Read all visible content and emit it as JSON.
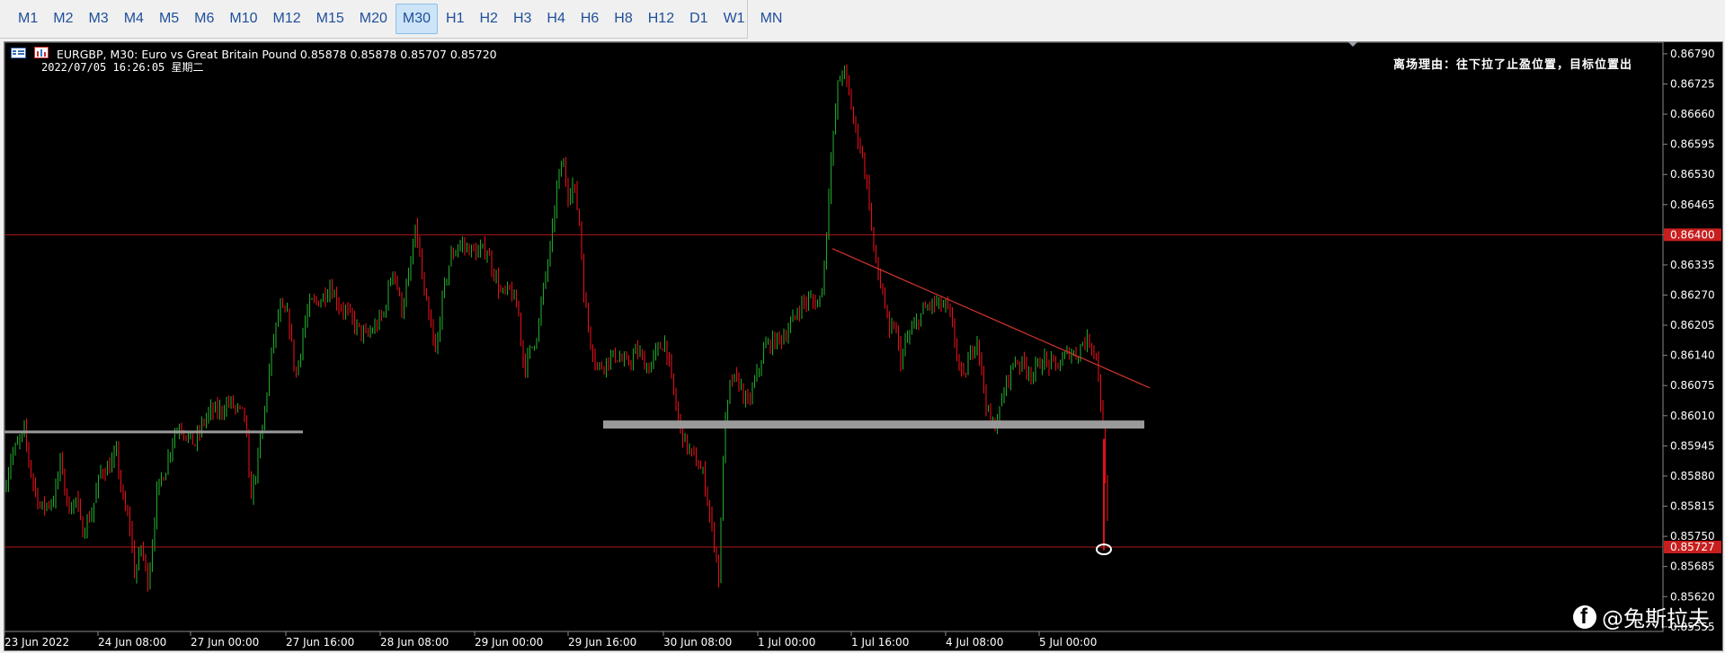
{
  "timeframes": [
    "M1",
    "M2",
    "M3",
    "M4",
    "M5",
    "M6",
    "M10",
    "M12",
    "M15",
    "M20",
    "M30",
    "H1",
    "H2",
    "H3",
    "H4",
    "H6",
    "H8",
    "H12",
    "D1",
    "W1",
    "MN"
  ],
  "active_timeframe": "M30",
  "chart": {
    "header": "EURGBP, M30:  Euro vs Great Britain Pound  0.85878 0.85878 0.85707 0.85720",
    "datetime": "2022/07/05  16:26:05  星期二",
    "note": "离场理由：往下拉了止盈位置，目标位置出",
    "watermark": "@兔斯拉夫",
    "colors": {
      "bull": "#1fa52a",
      "bear": "#e0101a",
      "background": "#000000",
      "hline": "#b01818",
      "zone": "#9a9a9a",
      "price_box": "#c81e1e"
    }
  },
  "chart_data": {
    "type": "candlestick",
    "symbol": "EURGBP",
    "timeframe": "M30",
    "ylim": [
      0.85545,
      0.86815
    ],
    "y_ticks": [
      "0.86790",
      "0.86725",
      "0.86660",
      "0.86595",
      "0.86530",
      "0.86465",
      "0.86400",
      "0.86335",
      "0.86270",
      "0.86205",
      "0.86140",
      "0.86075",
      "0.86010",
      "0.85945",
      "0.85880",
      "0.85815",
      "0.85750",
      "0.85685",
      "0.85620",
      "0.85555"
    ],
    "x_ticks": [
      "23 Jun 2022",
      "24 Jun 08:00",
      "27 Jun 00:00",
      "27 Jun 16:00",
      "28 Jun 08:00",
      "29 Jun 00:00",
      "29 Jun 16:00",
      "30 Jun 08:00",
      "1 Jul 00:00",
      "1 Jul 16:00",
      "4 Jul 08:00",
      "5 Jul 00:00"
    ],
    "price_labels": [
      "0.86400",
      "0.85727"
    ],
    "horizontal_lines": [
      0.864,
      0.85727
    ],
    "support_zones": [
      0.85975,
      0.8599
    ],
    "trendline": [
      0.8637,
      0.8607
    ],
    "last_close": 0.8572,
    "path": [
      [
        0,
        0.8585
      ],
      [
        7,
        0.8592
      ],
      [
        22,
        0.85975
      ],
      [
        30,
        0.8588
      ],
      [
        40,
        0.8581
      ],
      [
        55,
        0.8583
      ],
      [
        63,
        0.8592
      ],
      [
        70,
        0.8581
      ],
      [
        80,
        0.8583
      ],
      [
        86,
        0.8576
      ],
      [
        97,
        0.858
      ],
      [
        107,
        0.8589
      ],
      [
        117,
        0.859
      ],
      [
        125,
        0.8593
      ],
      [
        131,
        0.8583
      ],
      [
        140,
        0.8577
      ],
      [
        145,
        0.8566
      ],
      [
        152,
        0.8573
      ],
      [
        160,
        0.8565
      ],
      [
        170,
        0.8585
      ],
      [
        180,
        0.859
      ],
      [
        188,
        0.8597
      ],
      [
        196,
        0.8599
      ],
      [
        205,
        0.8596
      ],
      [
        212,
        0.8595
      ],
      [
        222,
        0.86
      ],
      [
        230,
        0.8602
      ],
      [
        240,
        0.8602
      ],
      [
        250,
        0.8604
      ],
      [
        260,
        0.8602
      ],
      [
        268,
        0.8601
      ],
      [
        273,
        0.8583
      ],
      [
        280,
        0.8589
      ],
      [
        288,
        0.86
      ],
      [
        298,
        0.8616
      ],
      [
        306,
        0.8624
      ],
      [
        316,
        0.8622
      ],
      [
        324,
        0.8609
      ],
      [
        334,
        0.8621
      ],
      [
        340,
        0.8625
      ],
      [
        352,
        0.8626
      ],
      [
        362,
        0.8629
      ],
      [
        372,
        0.8625
      ],
      [
        382,
        0.8623
      ],
      [
        392,
        0.862
      ],
      [
        402,
        0.8618
      ],
      [
        412,
        0.862
      ],
      [
        422,
        0.8623
      ],
      [
        432,
        0.8633
      ],
      [
        442,
        0.8624
      ],
      [
        450,
        0.8631
      ],
      [
        458,
        0.8642
      ],
      [
        466,
        0.8628
      ],
      [
        473,
        0.8621
      ],
      [
        480,
        0.8614
      ],
      [
        486,
        0.8625
      ],
      [
        496,
        0.8635
      ],
      [
        506,
        0.8638
      ],
      [
        516,
        0.8637
      ],
      [
        526,
        0.8636
      ],
      [
        536,
        0.8637
      ],
      [
        546,
        0.8631
      ],
      [
        553,
        0.8627
      ],
      [
        563,
        0.8628
      ],
      [
        572,
        0.8623
      ],
      [
        578,
        0.8611
      ],
      [
        585,
        0.8615
      ],
      [
        593,
        0.8619
      ],
      [
        600,
        0.8629
      ],
      [
        608,
        0.8638
      ],
      [
        615,
        0.8651
      ],
      [
        621,
        0.8656
      ],
      [
        627,
        0.8649
      ],
      [
        633,
        0.8651
      ],
      [
        640,
        0.8642
      ],
      [
        645,
        0.8626
      ],
      [
        652,
        0.8617
      ],
      [
        660,
        0.8611
      ],
      [
        670,
        0.8613
      ],
      [
        680,
        0.8614
      ],
      [
        692,
        0.8612
      ],
      [
        704,
        0.8615
      ],
      [
        716,
        0.8611
      ],
      [
        726,
        0.8615
      ],
      [
        735,
        0.8617
      ],
      [
        740,
        0.8611
      ],
      [
        746,
        0.8604
      ],
      [
        752,
        0.8598
      ],
      [
        760,
        0.8594
      ],
      [
        770,
        0.8591
      ],
      [
        778,
        0.8588
      ],
      [
        785,
        0.8579
      ],
      [
        791,
        0.8572
      ],
      [
        795,
        0.8565
      ],
      [
        800,
        0.8596
      ],
      [
        808,
        0.8609
      ],
      [
        818,
        0.8608
      ],
      [
        826,
        0.8603
      ],
      [
        836,
        0.8609
      ],
      [
        846,
        0.8616
      ],
      [
        856,
        0.8617
      ],
      [
        866,
        0.8618
      ],
      [
        876,
        0.8621
      ],
      [
        886,
        0.8625
      ],
      [
        896,
        0.8626
      ],
      [
        906,
        0.8625
      ],
      [
        912,
        0.8633
      ],
      [
        918,
        0.8653
      ],
      [
        922,
        0.8661
      ],
      [
        927,
        0.8672
      ],
      [
        933,
        0.8676
      ],
      [
        939,
        0.8671
      ],
      [
        945,
        0.8664
      ],
      [
        951,
        0.866
      ],
      [
        957,
        0.8654
      ],
      [
        962,
        0.8647
      ],
      [
        966,
        0.8638
      ],
      [
        972,
        0.8631
      ],
      [
        978,
        0.8627
      ],
      [
        984,
        0.8618
      ],
      [
        990,
        0.8621
      ],
      [
        997,
        0.8613
      ],
      [
        1005,
        0.8618
      ],
      [
        1012,
        0.862
      ],
      [
        1020,
        0.8623
      ],
      [
        1030,
        0.8625
      ],
      [
        1040,
        0.8625
      ],
      [
        1050,
        0.8624
      ],
      [
        1058,
        0.8616
      ],
      [
        1066,
        0.8608
      ],
      [
        1074,
        0.8614
      ],
      [
        1082,
        0.8618
      ],
      [
        1090,
        0.8606
      ],
      [
        1098,
        0.8598
      ],
      [
        1106,
        0.8601
      ],
      [
        1114,
        0.8608
      ],
      [
        1124,
        0.8613
      ],
      [
        1134,
        0.8612
      ],
      [
        1144,
        0.861
      ],
      [
        1154,
        0.8613
      ],
      [
        1164,
        0.8612
      ],
      [
        1174,
        0.8612
      ],
      [
        1184,
        0.8615
      ],
      [
        1192,
        0.8614
      ],
      [
        1200,
        0.8617
      ],
      [
        1208,
        0.8617
      ],
      [
        1215,
        0.8614
      ],
      [
        1219,
        0.8605
      ],
      [
        1223,
        0.8596
      ],
      [
        1226,
        0.858
      ],
      [
        1229,
        0.8572
      ]
    ]
  }
}
